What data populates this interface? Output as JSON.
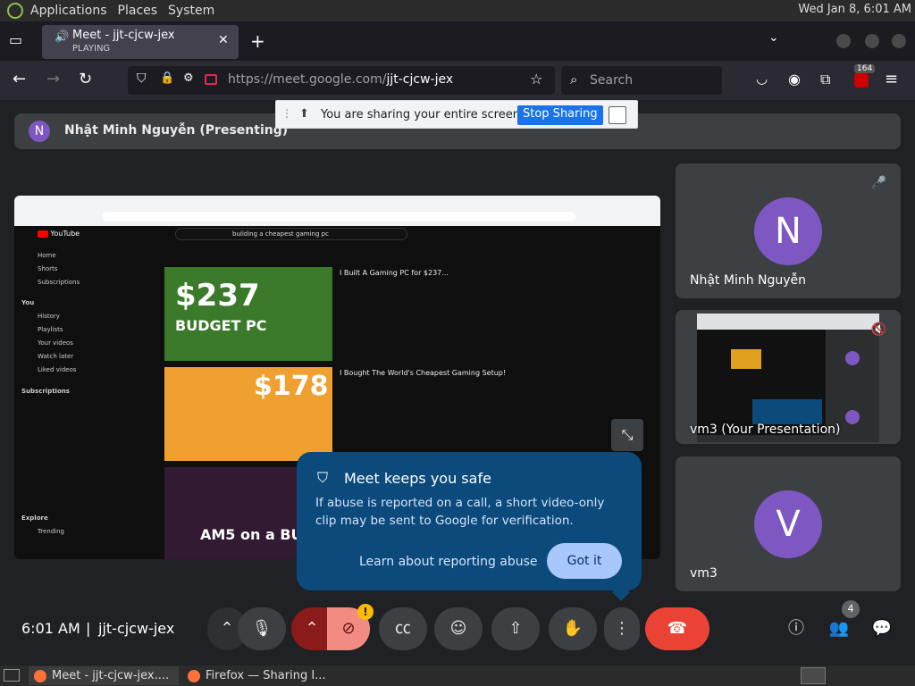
{
  "top_panel": {
    "menus": [
      "Applications",
      "Places",
      "System"
    ],
    "clock": "Wed Jan  8,  6:01 AM"
  },
  "browser": {
    "tab_title": "Meet - jjt-cjcw-jex",
    "tab_status": "PLAYING",
    "url_host": "https://meet.google.com/",
    "url_path": "jjt-cjcw-jex",
    "search_placeholder": "Search",
    "extension_badge": "164"
  },
  "sharing_banner": {
    "message": "You are sharing your entire screen.",
    "stop_label": "Stop Sharing"
  },
  "presenter": {
    "avatar_letter": "N",
    "name": "Nhật Minh Nguyễn (Presenting)"
  },
  "shared_screen": {
    "search_query": "building a cheapest gaming pc",
    "sidebar": [
      "Home",
      "Shorts",
      "Subscriptions",
      "You",
      "History",
      "Playlists",
      "Your videos",
      "Watch later",
      "Liked videos",
      "Subscriptions",
      "Explore",
      "Trending"
    ],
    "videos": [
      {
        "title": "I Built A Gaming PC for $237...",
        "thumb_text": "$237",
        "thumb_sub": "BUDGET PC"
      },
      {
        "title": "I Bought The World's Cheapest Gaming Setup!",
        "thumb_text": "$178",
        "thumb_sub": ""
      },
      {
        "title": "",
        "thumb_text": "AM5 on a BUDG",
        "thumb_sub": ""
      }
    ]
  },
  "tiles": [
    {
      "letter": "N",
      "name": "Nhật Minh Nguyễn",
      "color": "#7e57c2"
    },
    {
      "letter": "",
      "name": "vm3 (Your Presentation)",
      "color": ""
    },
    {
      "letter": "V",
      "name": "vm3",
      "color": "#7e57c2"
    }
  ],
  "safe_popup": {
    "title": "Meet keeps you safe",
    "body": "If abuse is reported on a call, a short video-only clip may be sent to Google for verification.",
    "learn_label": "Learn about reporting abuse",
    "got_it_label": "Got it"
  },
  "bottom_bar": {
    "time": "6:01 AM",
    "separator": "|",
    "meeting_code": "jjt-cjcw-jex",
    "people_count": "4",
    "camera_alert": "!"
  },
  "taskbar": {
    "items": [
      "Meet - jjt-cjcw-jex....",
      "Firefox — Sharing I..."
    ]
  },
  "colors": {
    "accent_blue": "#1a73e8",
    "end_call_red": "#ea4335",
    "muted_red": "#8b1a1a",
    "popup_bg": "#0b4a7a"
  }
}
